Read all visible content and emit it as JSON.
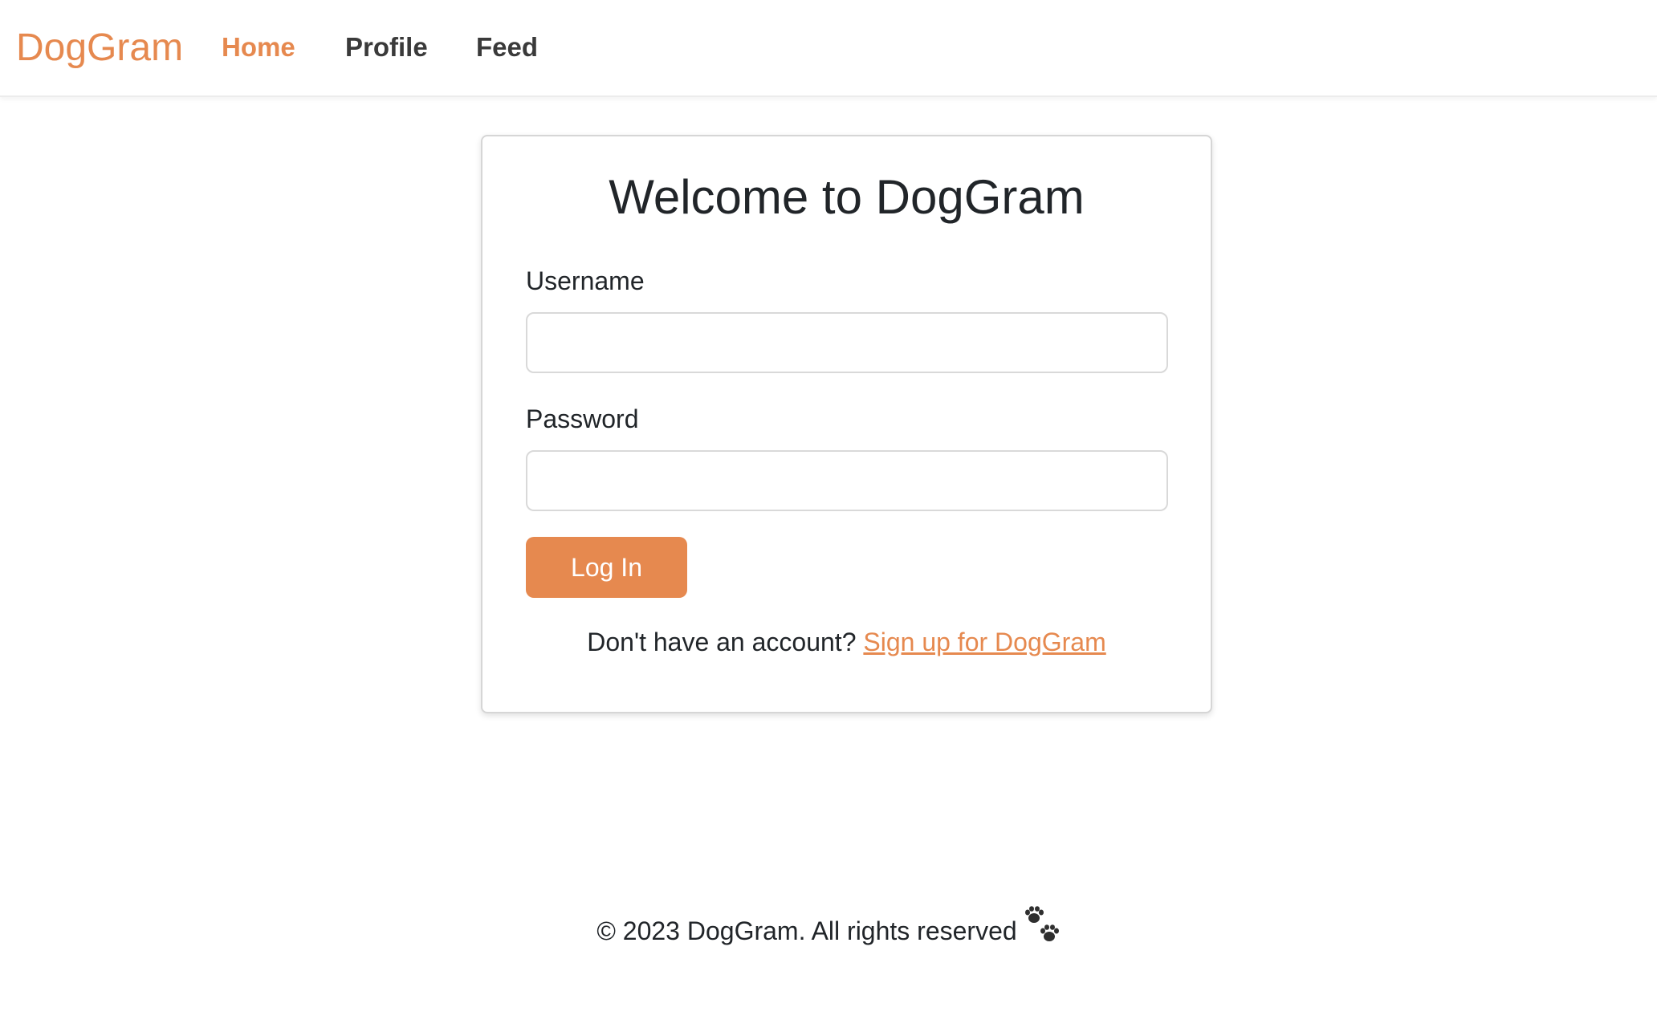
{
  "navbar": {
    "brand": "DogGram",
    "links": [
      {
        "label": "Home",
        "active": true
      },
      {
        "label": "Profile",
        "active": false
      },
      {
        "label": "Feed",
        "active": false
      }
    ]
  },
  "login_card": {
    "title": "Welcome to DogGram",
    "username_label": "Username",
    "username_value": "",
    "password_label": "Password",
    "password_value": "",
    "submit_label": "Log In",
    "signup_prompt": "Don't have an account?",
    "signup_link": "Sign up for DogGram"
  },
  "footer": {
    "text": "© 2023 DogGram. All rights reserved",
    "icon": "paw-prints-icon"
  },
  "colors": {
    "accent": "#e6894f",
    "text": "#212529",
    "nav_text": "#3a3a3a",
    "card_border": "#d6d6d6"
  }
}
